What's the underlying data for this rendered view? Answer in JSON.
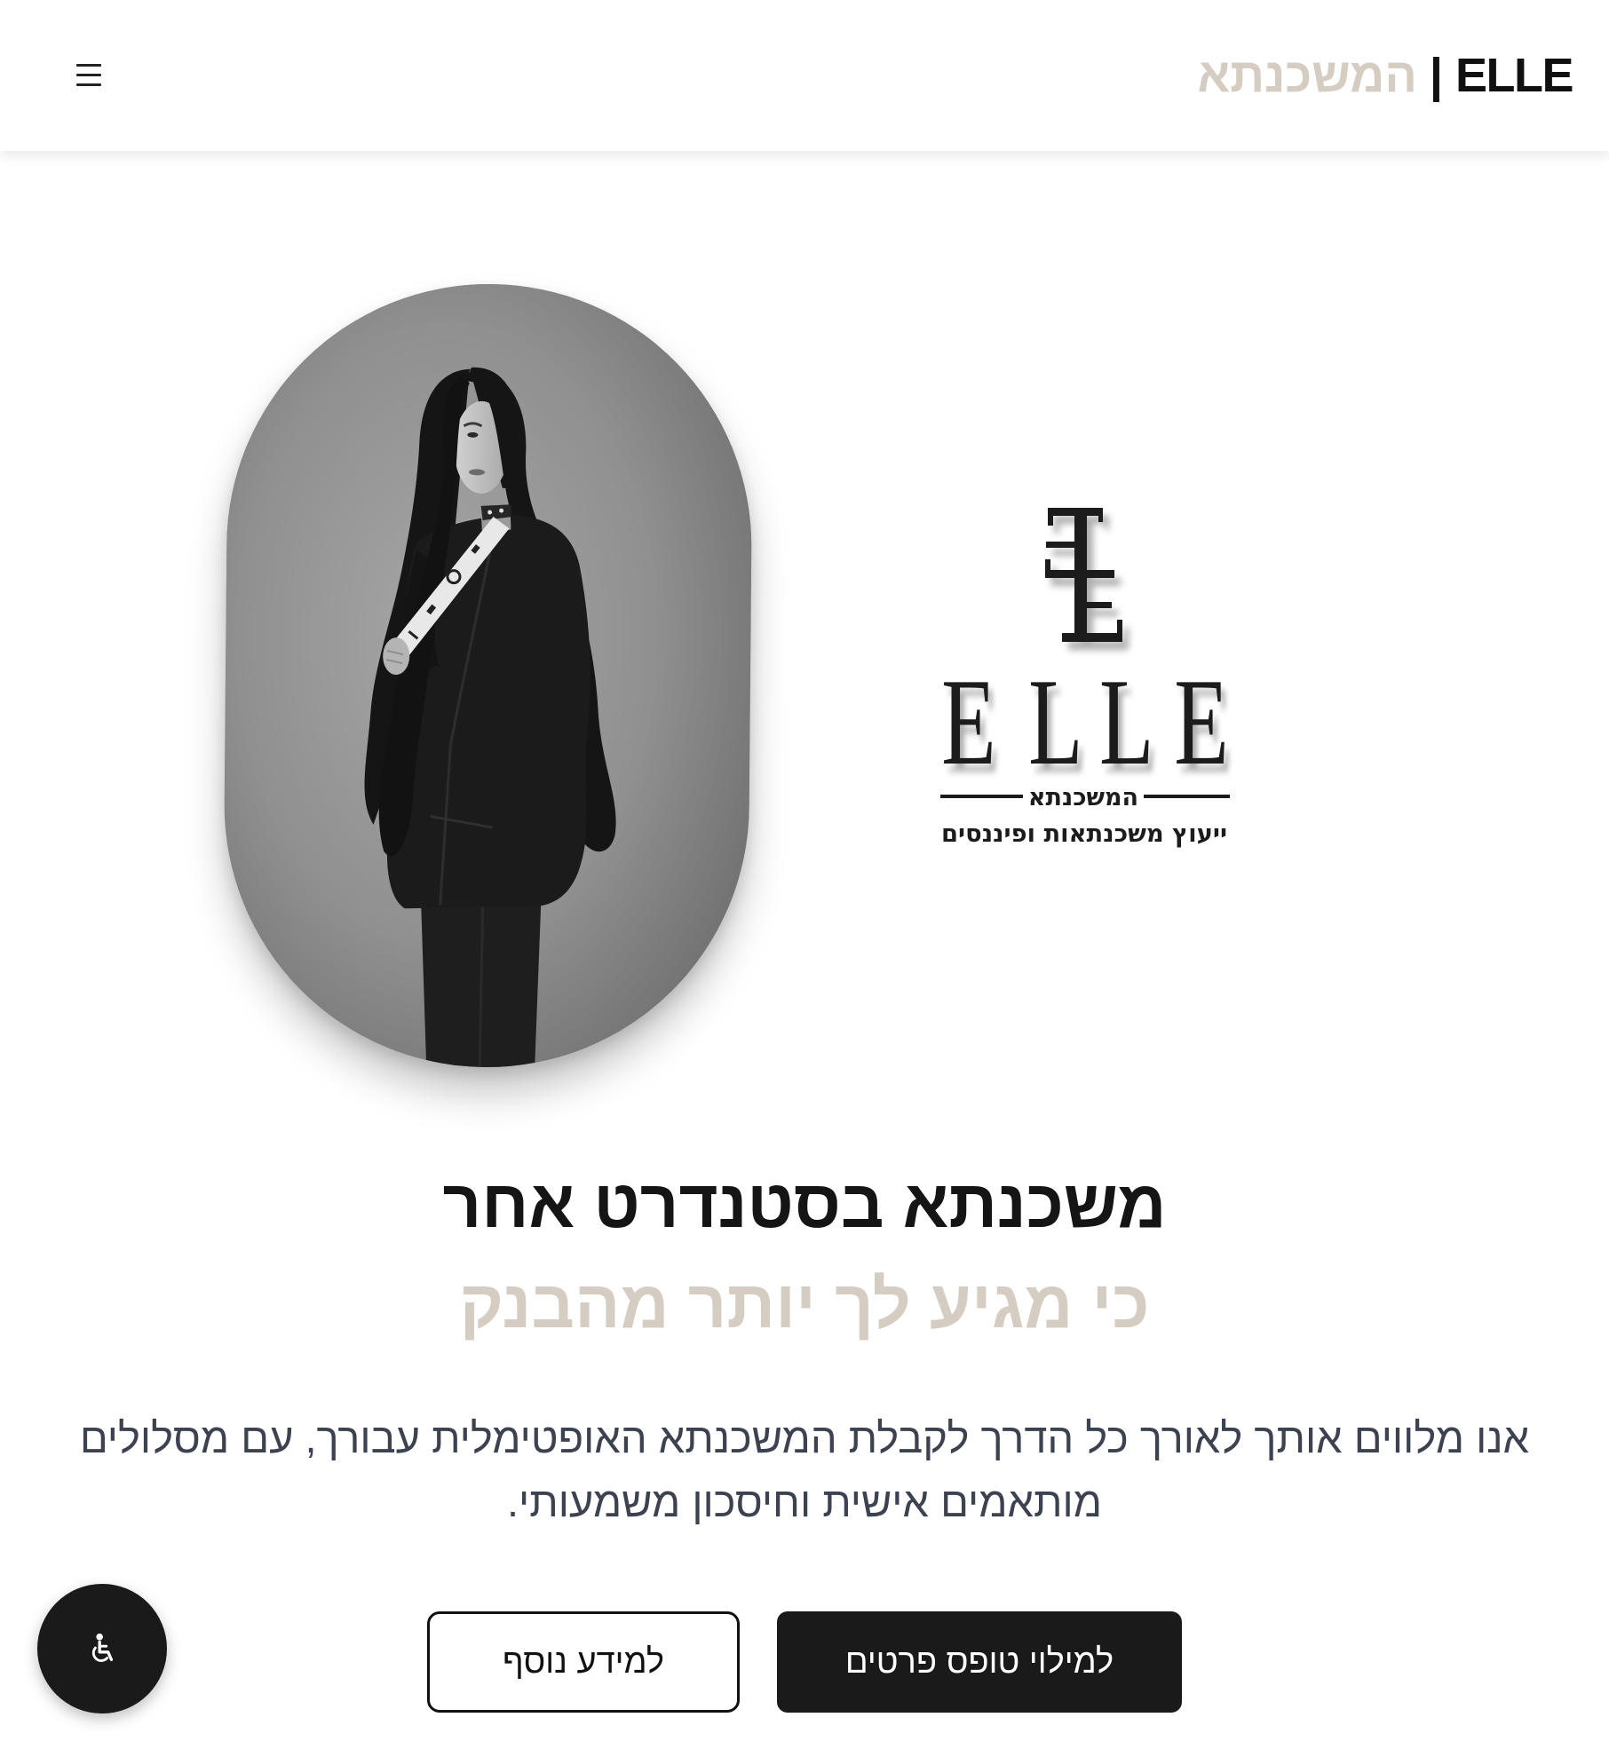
{
  "header": {
    "brand_name": "ELLE",
    "brand_separator": "|",
    "brand_subtitle": "המשכנתא",
    "menu_icon": "hamburger-menu-icon"
  },
  "hero": {
    "logo": {
      "wordmark": "ELLE",
      "name": "המשכנתא",
      "tagline": "ייעוץ משכנתאות ופיננסים"
    },
    "title": "משכנתא בסטנדרט אחר",
    "subtitle": "כי מגיע לך יותר מהבנק",
    "description": "אנו מלווים אותך לאורך כל הדרך לקבלת המשכנתא האופטימלית עבורך, עם מסלולים מותאמים אישית וחיסכון משמעותי.",
    "primary_button": {
      "label": "למילוי טופס פרטים"
    },
    "secondary_button": {
      "label": "למידע נוסף"
    }
  },
  "accessibility_button": {
    "icon": "accessibility-icon"
  },
  "colors": {
    "accent": "#d6cdc2",
    "dark": "#1a1a1a",
    "text": "#3d4250",
    "background": "#ffffff"
  }
}
